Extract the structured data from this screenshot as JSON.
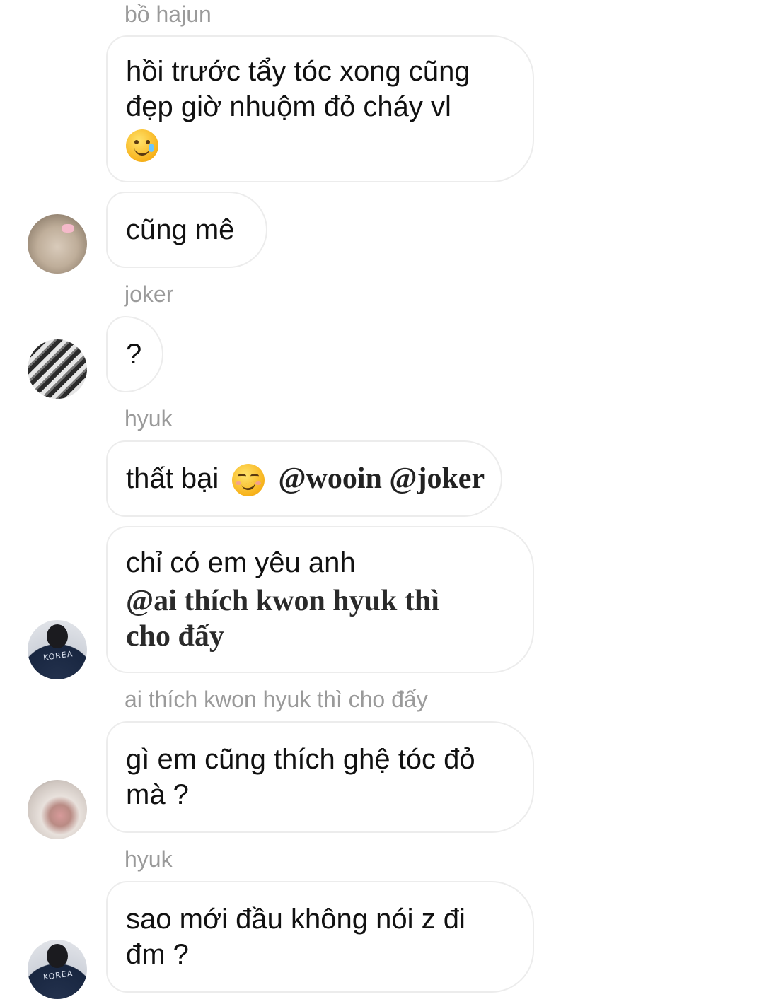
{
  "messages": [
    {
      "sender": "bồ hajun",
      "lines": [
        "hồi trước tẩy tóc xong cũng",
        "đẹp giờ nhuộm đỏ cháy vl"
      ],
      "emoji": "smiling-face-with-tear-emoji"
    },
    {
      "sender": "",
      "text": "cũng mê",
      "avatar": "rabbit-avatar"
    },
    {
      "sender": "joker",
      "text": "?",
      "avatar": "manga-avatar"
    },
    {
      "sender": "hyuk",
      "text": "thất bại",
      "emoji": "smirking-face-emoji",
      "mentions": "@wooin @joker"
    },
    {
      "sender": "",
      "text": "chỉ có em yêu anh",
      "mention_lines": [
        "@ai thích kwon hyuk thì",
        "cho đấy"
      ],
      "avatar": "korea-jacket-avatar",
      "avatar_text": "KOREA"
    },
    {
      "sender": "ai thích kwon hyuk thì cho đấy",
      "lines": [
        "gì em cũng thích ghệ tóc đỏ",
        "mà ?"
      ],
      "avatar": "cat-avatar"
    },
    {
      "sender": "hyuk",
      "lines": [
        "sao mới đầu không nói z đi",
        "đm ?"
      ],
      "avatar": "korea-jacket-avatar",
      "avatar_text": "KOREA"
    }
  ]
}
